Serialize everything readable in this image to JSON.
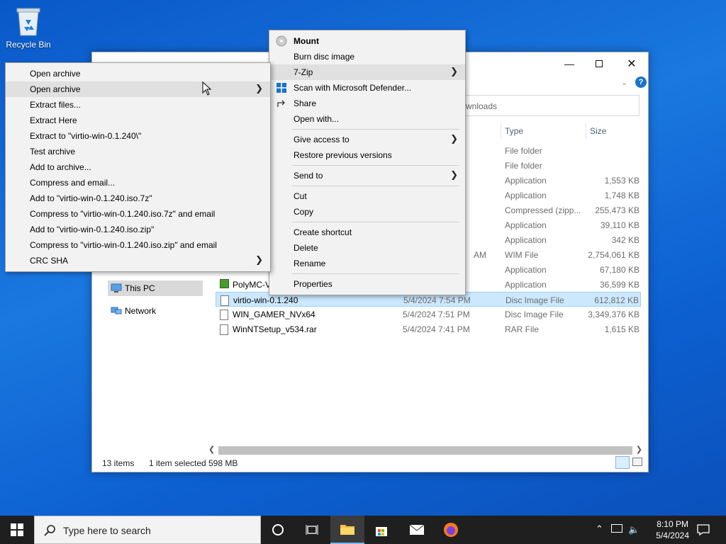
{
  "desktop": {
    "recycle_bin": "Recycle Bin"
  },
  "explorer": {
    "address_partial": "wnloads",
    "columns": {
      "type": "Type",
      "size": "Size"
    },
    "nav": {
      "this_pc": "This PC",
      "network": "Network"
    },
    "files": [
      {
        "name": "",
        "date": "",
        "type": "File folder",
        "size": ""
      },
      {
        "name": "",
        "date": "",
        "type": "File folder",
        "size": ""
      },
      {
        "name": "",
        "date": "",
        "type": "Application",
        "size": "1,553 KB"
      },
      {
        "name": "",
        "date": "",
        "type": "Application",
        "size": "1,748 KB"
      },
      {
        "name": "",
        "date": "",
        "type": "Compressed (zipp...",
        "size": "255,473 KB"
      },
      {
        "name": "",
        "date": "",
        "type": "Application",
        "size": "39,110 KB"
      },
      {
        "name": "",
        "date": "",
        "type": "Application",
        "size": "342 KB"
      },
      {
        "name": "",
        "date": "AM",
        "type": "WIM File",
        "size": "2,754,061 KB"
      },
      {
        "name": "",
        "date": "",
        "type": "Application",
        "size": "67,180 KB"
      },
      {
        "name": "PolyMC-V",
        "date": "",
        "type": "Application",
        "size": "36,599 KB"
      },
      {
        "name": "virtio-win-0.1.240",
        "date": "5/4/2024 7:54 PM",
        "type": "Disc Image File",
        "size": "612,812 KB"
      },
      {
        "name": "WIN_GAMER_NVx64",
        "date": "5/4/2024 7:51 PM",
        "type": "Disc Image File",
        "size": "3,349,376 KB"
      },
      {
        "name": "WinNTSetup_v534.rar",
        "date": "5/4/2024 7:41 PM",
        "type": "RAR File",
        "size": "1,615 KB"
      }
    ],
    "status": {
      "items": "13 items",
      "selected": "1 item selected",
      "size": "598 MB"
    }
  },
  "context_menu": {
    "mount": "Mount",
    "burn": "Burn disc image",
    "sevenzip": "7-Zip",
    "defender": "Scan with Microsoft Defender...",
    "share": "Share",
    "open_with": "Open with...",
    "give_access": "Give access to",
    "restore": "Restore previous versions",
    "send_to": "Send to",
    "cut": "Cut",
    "copy": "Copy",
    "create_shortcut": "Create shortcut",
    "delete": "Delete",
    "rename": "Rename",
    "properties": "Properties"
  },
  "sevenzip_menu": {
    "open_archive": "Open archive",
    "open_archive_sub": "Open archive",
    "extract_files": "Extract files...",
    "extract_here": "Extract Here",
    "extract_to": "Extract to \"virtio-win-0.1.240\\\"",
    "test_archive": "Test archive",
    "add_to_archive": "Add to archive...",
    "compress_email": "Compress and email...",
    "add_7z": "Add to \"virtio-win-0.1.240.iso.7z\"",
    "compress_7z_email": "Compress to \"virtio-win-0.1.240.iso.7z\" and email",
    "add_zip": "Add to \"virtio-win-0.1.240.iso.zip\"",
    "compress_zip_email": "Compress to \"virtio-win-0.1.240.iso.zip\" and email",
    "crc_sha": "CRC SHA"
  },
  "taskbar": {
    "search_placeholder": "Type here to search",
    "time": "8:10 PM",
    "date": "5/4/2024"
  },
  "colors": {
    "accent": "#0078d7",
    "selection": "#cce8ff",
    "taskbar": "#1f1f1f"
  }
}
